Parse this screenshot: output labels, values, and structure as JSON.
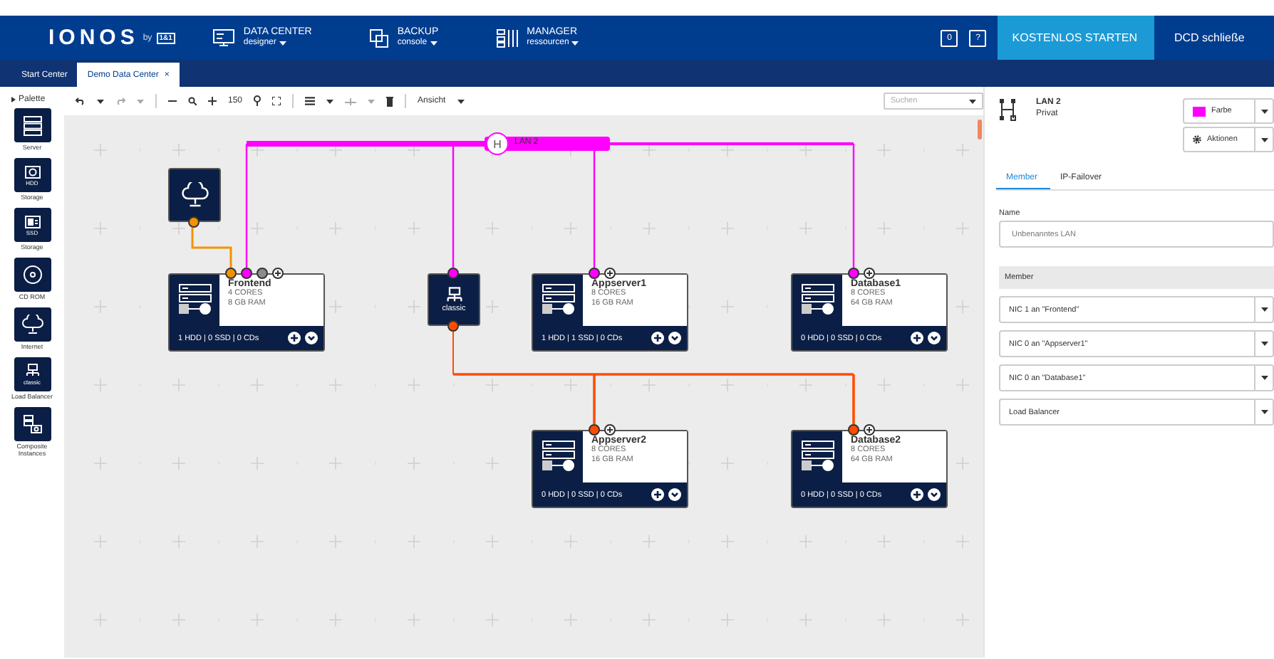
{
  "topbar": {
    "logo": "IONOS",
    "logo_by": "by",
    "logo_brand": "1&1",
    "nav": [
      {
        "title": "DATA CENTER",
        "subtitle": "designer",
        "kind": "designer"
      },
      {
        "title": "BACKUP",
        "subtitle": "console",
        "kind": "backup"
      },
      {
        "title": "MANAGER",
        "subtitle": "ressourcen",
        "kind": "manager"
      }
    ],
    "counter": "0",
    "help": "?",
    "cta": "KOSTENLOS STARTEN",
    "close": "DCD schließe"
  },
  "tabs": [
    {
      "label": "Start Center",
      "selected": false
    },
    {
      "label": "Demo Data Center",
      "selected": true,
      "close": "×"
    }
  ],
  "palette": {
    "title": "Palette",
    "items": [
      {
        "label": "Server",
        "kind": "server"
      },
      {
        "label": "Storage",
        "badge": "HDD",
        "kind": "hdd"
      },
      {
        "label": "Storage",
        "badge": "SSD",
        "kind": "ssd"
      },
      {
        "label": "CD ROM",
        "kind": "cd"
      },
      {
        "label": "Internet",
        "kind": "internet"
      },
      {
        "label": "Load Balancer",
        "badge": "classic",
        "kind": "lb"
      },
      {
        "label": "Composite Instances",
        "kind": "composite"
      }
    ]
  },
  "toolbar": {
    "zoom": "150",
    "view": "Ansicht",
    "search_placeholder": "Suchen"
  },
  "canvas": {
    "lan": {
      "label": "LAN 2",
      "badge": "H",
      "color": "#ff00ff"
    },
    "lb_link": {
      "color": "#ff4d00"
    },
    "nodes": [
      {
        "kind": "internet",
        "ports": [
          {
            "color": "#f39200"
          }
        ]
      },
      {
        "kind": "server",
        "name": "Frontend",
        "cores": "4 CORES",
        "ram": "8 GB RAM",
        "storage": "1 HDD | 0 SSD | 0 CDs",
        "ports": [
          {
            "color": "#f39200"
          },
          {
            "color": "#ff00ff"
          },
          {
            "color": "#8c8c8c"
          }
        ]
      },
      {
        "kind": "lb",
        "label": "classic",
        "ports": [
          {
            "color": "#ff00ff"
          },
          {
            "color": "#ff4d00"
          }
        ]
      },
      {
        "kind": "server",
        "name": "Appserver1",
        "cores": "8 CORES",
        "ram": "16 GB RAM",
        "storage": "1 HDD | 1 SSD | 0 CDs",
        "ports": [
          {
            "color": "#ff00ff"
          }
        ]
      },
      {
        "kind": "server",
        "name": "Database1",
        "cores": "8 CORES",
        "ram": "64 GB RAM",
        "storage": "0 HDD | 0 SSD | 0 CDs",
        "ports": [
          {
            "color": "#ff00ff"
          }
        ]
      },
      {
        "kind": "server",
        "name": "Appserver2",
        "cores": "8 CORES",
        "ram": "16 GB RAM",
        "storage": "0 HDD | 0 SSD | 0 CDs",
        "ports": [
          {
            "color": "#ff4d00"
          }
        ]
      },
      {
        "kind": "server",
        "name": "Database2",
        "cores": "8 CORES",
        "ram": "64 GB RAM",
        "storage": "0 HDD | 0 SSD | 0 CDs",
        "ports": [
          {
            "color": "#ff4d00"
          }
        ]
      }
    ]
  },
  "panel": {
    "title": "LAN 2",
    "subtitle": "Privat",
    "color_button": "Farbe",
    "color": "#ff00ff",
    "actions_button": "Aktionen",
    "tabs": [
      {
        "label": "Member",
        "selected": true
      },
      {
        "label": "IP-Failover",
        "selected": false
      }
    ],
    "name_label": "Name",
    "name_placeholder": "Unbenanntes LAN",
    "member_header": "Member",
    "members": [
      "NIC 1 an \"Frontend\"",
      "NIC 0 an \"Appserver1\"",
      "NIC 0 an \"Database1\"",
      "Load Balancer"
    ]
  }
}
